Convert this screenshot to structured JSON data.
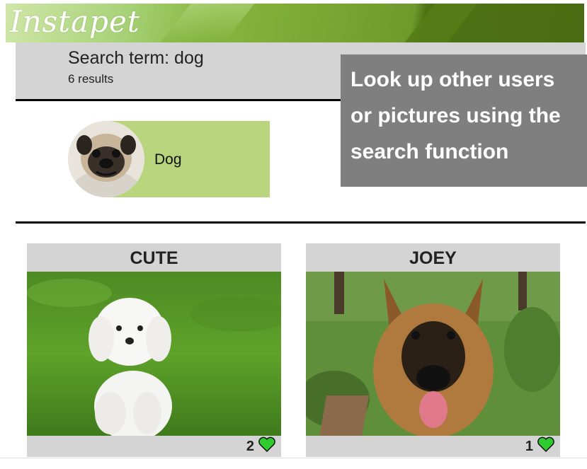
{
  "header": {
    "logo_text": "Instapet"
  },
  "search": {
    "term_label": "Search term: dog",
    "result_count": "6 results"
  },
  "tooltip": {
    "lines": [
      "Look up other users",
      "or pictures using the",
      "search function"
    ]
  },
  "users": [
    {
      "name": "Dog",
      "avatar": "pug-photo"
    }
  ],
  "posts": [
    {
      "title": "CUTE",
      "image": "white-maltese-puppy-on-grass",
      "likes": "2",
      "like_icon": "green-heart-icon"
    },
    {
      "title": "JOEY",
      "image": "german-shepherd-in-garden",
      "likes": "1",
      "like_icon": "green-heart-icon"
    }
  ],
  "colors": {
    "banner_green": "#7aa634",
    "card_green": "#b8d57d",
    "panel_gray": "#d4d4d4",
    "tooltip_gray": "#7f7f7f",
    "heart_green": "#2ecc2e"
  }
}
